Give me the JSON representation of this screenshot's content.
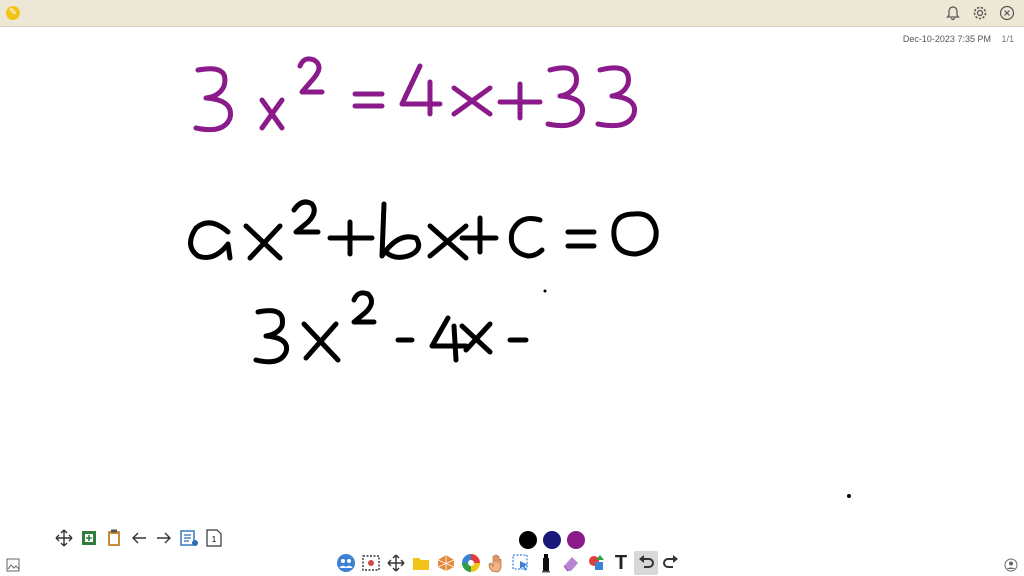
{
  "header": {
    "timestamp": "Dec-10-2023 7:35 PM",
    "page_indicator": "1/1",
    "icons": [
      "pencil-icon",
      "bell-icon",
      "gear-icon",
      "close-icon"
    ]
  },
  "whiteboard": {
    "lines": [
      {
        "name": "original-equation",
        "text": "3x^2 = 4x + 33",
        "color": "#8b1a8b"
      },
      {
        "name": "standard-form",
        "text": "ax^2 + bx + c = 0",
        "color": "#000000"
      },
      {
        "name": "rearranged-equation",
        "text": "3x^2 - 4x -",
        "color": "#000000"
      }
    ]
  },
  "page_navigator": {
    "page_number": "1",
    "tools": [
      "move-icon",
      "add-page-icon",
      "paste-icon",
      "prev-page-icon",
      "next-page-icon",
      "page-list-icon",
      "page-number-icon"
    ]
  },
  "pen_colors": [
    "#000000",
    "#1a1a7a",
    "#8b1a8b"
  ],
  "main_toolbar": {
    "tools": [
      "people-icon",
      "screenshot-icon",
      "move-icon",
      "folder-icon",
      "shapes-icon",
      "color-wheel-icon",
      "hand-icon",
      "select-icon",
      "marker-icon",
      "eraser-icon",
      "shape-tool-icon",
      "text-icon",
      "undo-icon",
      "redo-icon"
    ],
    "text_tool_label": "T"
  }
}
